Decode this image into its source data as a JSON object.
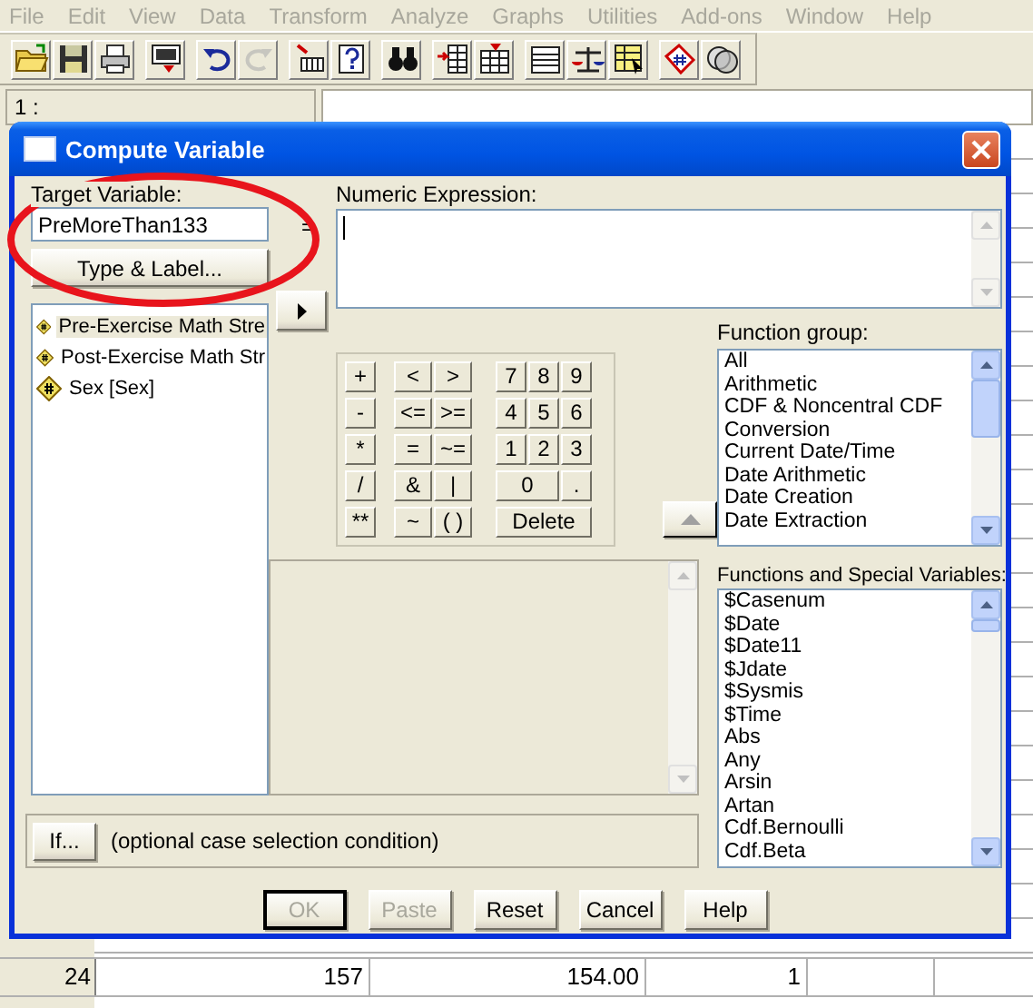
{
  "menu": [
    {
      "label": "File",
      "disabled": true
    },
    {
      "label": "Edit",
      "disabled": true
    },
    {
      "label": "View",
      "disabled": true
    },
    {
      "label": "Data",
      "disabled": true
    },
    {
      "label": "Transform",
      "disabled": true
    },
    {
      "label": "Analyze",
      "disabled": true
    },
    {
      "label": "Graphs",
      "disabled": true
    },
    {
      "label": "Utilities",
      "disabled": true
    },
    {
      "label": "Add-ons",
      "disabled": true
    },
    {
      "label": "Window",
      "disabled": true
    },
    {
      "label": "Help",
      "disabled": true
    }
  ],
  "toolbar": {
    "groups": [
      {
        "buttons": [
          {
            "disabled": false
          },
          {
            "disabled": false
          },
          {
            "disabled": false
          }
        ]
      },
      {
        "buttons": [
          {
            "disabled": false
          }
        ]
      },
      {
        "buttons": [
          {
            "disabled": false
          },
          {
            "disabled": true
          }
        ]
      },
      {
        "buttons": [
          {
            "disabled": false
          },
          {
            "disabled": false
          }
        ]
      },
      {
        "buttons": [
          {
            "disabled": false
          }
        ]
      },
      {
        "buttons": [
          {
            "disabled": false
          },
          {
            "disabled": false
          }
        ]
      },
      {
        "buttons": [
          {
            "disabled": false
          },
          {
            "disabled": false
          },
          {
            "disabled": false
          }
        ]
      },
      {
        "buttons": [
          {
            "disabled": false
          },
          {
            "disabled": false
          }
        ]
      }
    ]
  },
  "cell_editor": {
    "cell_ref": "1 :"
  },
  "data_grid": {
    "rows": [
      {
        "case": "24",
        "cells": [
          "157",
          "154.00",
          "1"
        ]
      }
    ]
  },
  "dialog": {
    "title": "Compute Variable",
    "target_variable": {
      "label": "Target Variable:",
      "value": "PreMoreThan133"
    },
    "equals": "=",
    "type_label_button": "Type & Label...",
    "variables": [
      {
        "label": "Pre-Exercise Math Stre",
        "selected": true
      },
      {
        "label": "Post-Exercise Math Str",
        "selected": false
      },
      {
        "label": "Sex [Sex]",
        "selected": false
      }
    ],
    "numeric_expression": {
      "label": "Numeric Expression:"
    },
    "keypad": [
      [
        "+",
        "<",
        ">",
        "7",
        "8",
        "9"
      ],
      [
        "-",
        "<=",
        ">=",
        "4",
        "5",
        "6"
      ],
      [
        "*",
        "=",
        "~=",
        "1",
        "2",
        "3"
      ],
      [
        "/",
        "&",
        "|",
        "0",
        "."
      ],
      [
        "**",
        "~",
        "( )",
        "Delete"
      ]
    ],
    "function_group": {
      "label": "Function group:",
      "items": [
        {
          "label": "All",
          "selected": false
        },
        {
          "label": "Arithmetic",
          "selected": false
        },
        {
          "label": "CDF & Noncentral CDF",
          "selected": false
        },
        {
          "label": "Conversion",
          "selected": false
        },
        {
          "label": "Current Date/Time",
          "selected": false
        },
        {
          "label": "Date Arithmetic",
          "selected": false
        },
        {
          "label": "Date Creation",
          "selected": false
        },
        {
          "label": "Date Extraction",
          "selected": false
        }
      ]
    },
    "functions": {
      "label": "Functions and Special Variables:",
      "items": [
        {
          "label": "$Casenum",
          "selected": false
        },
        {
          "label": "$Date",
          "selected": false
        },
        {
          "label": "$Date11",
          "selected": false
        },
        {
          "label": "$Jdate",
          "selected": false
        },
        {
          "label": "$Sysmis",
          "selected": false
        },
        {
          "label": "$Time",
          "selected": false
        },
        {
          "label": "Abs",
          "selected": false
        },
        {
          "label": "Any",
          "selected": false
        },
        {
          "label": "Arsin",
          "selected": false
        },
        {
          "label": "Artan",
          "selected": false
        },
        {
          "label": "Cdf.Bernoulli",
          "selected": false
        },
        {
          "label": "Cdf.Beta",
          "selected": false
        }
      ]
    },
    "if_button": "If...",
    "if_condition": "(optional case selection condition)",
    "buttons": [
      {
        "label": "OK",
        "disabled": true,
        "default": true
      },
      {
        "label": "Paste",
        "disabled": true,
        "default": false
      },
      {
        "label": "Reset",
        "disabled": false,
        "default": false
      },
      {
        "label": "Cancel",
        "disabled": false,
        "default": false
      },
      {
        "label": "Help",
        "disabled": false,
        "default": false
      }
    ]
  }
}
